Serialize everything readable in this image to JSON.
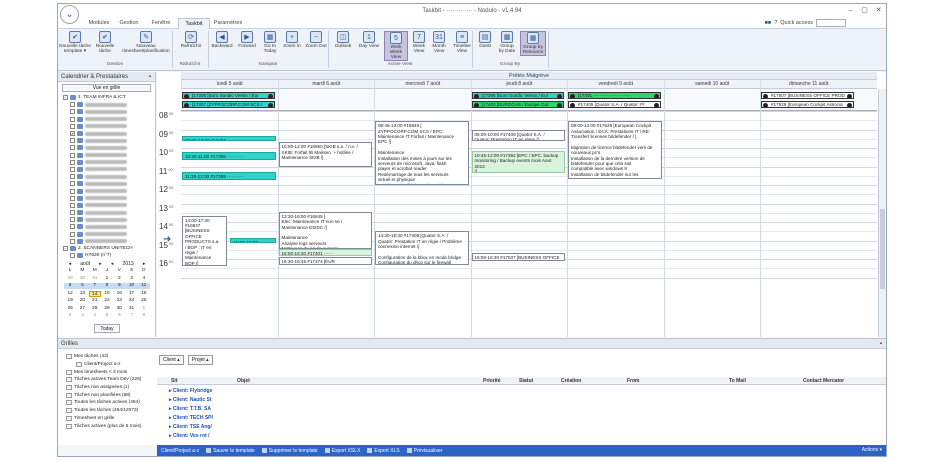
{
  "window": {
    "title": "Taskbit - ·············  - Nodulo - v1.4.94",
    "orb_icon": "chevron-down-icon",
    "controls": [
      "–",
      "▢",
      "✕"
    ]
  },
  "tabs": [
    {
      "label": "Modules"
    },
    {
      "label": "Gestion"
    },
    {
      "label": "Fenêtre"
    },
    {
      "label": "Taskbit",
      "active": true
    },
    {
      "label": "Paramètres"
    }
  ],
  "quick_access": {
    "flag": "■■",
    "help": "?",
    "label": "Quick access"
  },
  "ribbon": {
    "buttons": [
      {
        "label": "Nouvelle tâche\ntemplate ▾",
        "icon": "✔"
      },
      {
        "label": "Nouvelle\ntâche",
        "icon": "✔"
      },
      {
        "label": "Nouveau\ntimesheet/planification",
        "icon": "✎"
      },
      {
        "label": "Rafraîchir",
        "icon": "⟳"
      },
      {
        "label": "Backward",
        "icon": "◀"
      },
      {
        "label": "Forward",
        "icon": "▶"
      },
      {
        "label": "Go to\nToday",
        "icon": "▦"
      },
      {
        "label": "Zoom In",
        "icon": "+"
      },
      {
        "label": "Zoom Out",
        "icon": "−"
      },
      {
        "label": "Outlook",
        "icon": "◫"
      },
      {
        "label": "Day View",
        "icon": "1"
      },
      {
        "label": "Work\nWeek View",
        "icon": "5",
        "selected": true
      },
      {
        "label": "Week\nView",
        "icon": "7"
      },
      {
        "label": "Month\nView",
        "icon": "31"
      },
      {
        "label": "Timeline\nView",
        "icon": "≡"
      },
      {
        "label": "Gantt",
        "icon": "▤"
      },
      {
        "label": "Group\nby Date",
        "icon": "▦"
      },
      {
        "label": "Group by\nResource",
        "icon": "▦",
        "selected": true
      }
    ],
    "groups": [
      {
        "label": "Gestion"
      },
      {
        "label": "Rafraîchir"
      },
      {
        "label": "Navigate"
      },
      {
        "label": "Active View"
      },
      {
        "label": "Group By"
      }
    ]
  },
  "left_panel": {
    "title": "Calendrier & Prestataires",
    "view_button": "Vue en grille",
    "tree": [
      {
        "label": "1. TEAM INFRA & ICT",
        "level": 0,
        "box": "−",
        "icon": true
      },
      {
        "label": "",
        "level": 1,
        "box": ""
      },
      {
        "label": "",
        "level": 1,
        "box": ""
      },
      {
        "label": "",
        "level": 1,
        "box": ""
      },
      {
        "label": "",
        "level": 1,
        "box": ""
      },
      {
        "label": "",
        "level": 1,
        "box": "✔"
      },
      {
        "label": "",
        "level": 1,
        "box": ""
      },
      {
        "label": "",
        "level": 1,
        "box": ""
      },
      {
        "label": "",
        "level": 1,
        "box": ""
      },
      {
        "label": "",
        "level": 1,
        "box": ""
      },
      {
        "label": "",
        "level": 1,
        "box": ""
      },
      {
        "label": "",
        "level": 1,
        "box": ""
      },
      {
        "label": "",
        "level": 1,
        "box": ""
      },
      {
        "label": "",
        "level": 1,
        "box": ""
      },
      {
        "label": "",
        "level": 1,
        "box": ""
      },
      {
        "label": "",
        "level": 1,
        "box": ""
      },
      {
        "label": "",
        "level": 1,
        "box": ""
      },
      {
        "label": "",
        "level": 1,
        "box": ""
      },
      {
        "label": "",
        "level": 1,
        "box": ""
      },
      {
        "label": "",
        "level": 1,
        "box": ""
      },
      {
        "label": "",
        "level": 1,
        "box": ""
      },
      {
        "label": "2. SCANNERS UNITECH",
        "level": 0,
        "box": "−",
        "icon": true
      },
      {
        "label": "HT630 (n°7)",
        "level": 1,
        "box": "",
        "icon": true
      }
    ],
    "mini_calendar": {
      "month": "août",
      "year": "2013",
      "weekdays": [
        "L",
        "M",
        "M",
        "J",
        "V",
        "S",
        "D"
      ],
      "days": [
        "29",
        "30",
        "31",
        "1",
        "2",
        "3",
        "4",
        "5",
        "6",
        "7",
        "8",
        "9",
        "10",
        "11",
        "12",
        "13",
        "14",
        "15",
        "16",
        "17",
        "18",
        "19",
        "20",
        "21",
        "22",
        "23",
        "24",
        "25",
        "26",
        "27",
        "28",
        "29",
        "30",
        "31",
        "1",
        "2",
        "3",
        "4",
        "5",
        "6",
        "7",
        "8"
      ],
      "highlight": [
        "5",
        "6",
        "7",
        "8",
        "9",
        "10",
        "11"
      ],
      "today": "14"
    },
    "today_button": "Today"
  },
  "schedule": {
    "resource": "Prêtés Malgrève",
    "days": [
      "lundi 5 août",
      "mardi 6 août",
      "mercredi 7 août",
      "jeudi 8 août",
      "vendredi 9 août",
      "samedi 10 août",
      "dimanche 11 août"
    ],
    "hours": [
      "08",
      "09",
      "10",
      "11",
      "12",
      "13",
      "14",
      "15",
      "16"
    ],
    "minutes": "00",
    "allday": [
      {
        "day": 0,
        "row": 0,
        "text": "[17306 [Euro Sundic Versio / Eur",
        "color": "teal"
      },
      {
        "day": 0,
        "row": 1,
        "text": "[17307 [ZYPPOCORP.COM SCS /",
        "color": "teal"
      },
      {
        "day": 3,
        "row": 0,
        "text": "[17396 [Euro Sundic Versio / Eur",
        "color": "teal"
      },
      {
        "day": 3,
        "row": 1,
        "text": "[17403 [EUROGAS / Europe Cat",
        "color": "green"
      },
      {
        "day": 4,
        "row": 0,
        "text": "[17401 ························",
        "color": "green"
      },
      {
        "day": 4,
        "row": 1,
        "text": "#17405 [Quator S.A. / Quator: Pr",
        "color": "white"
      },
      {
        "day": 6,
        "row": 0,
        "text": "#17507 [BUSINESS OFFICE PROD",
        "color": "white"
      },
      {
        "day": 6,
        "row": 1,
        "text": "#17529 [European Cockpit Associa",
        "color": "white"
      }
    ],
    "events": [
      {
        "day": 0,
        "start": 9.35,
        "end": 9.6,
        "col": 0,
        "w": 1,
        "color": "teal",
        "text": "09:30-10:00 #17401"
      },
      {
        "day": 0,
        "start": 10.2,
        "end": 10.65,
        "col": 0,
        "w": 1,
        "color": "teal",
        "text": "10:30-11:00 #17399 ···········"
      },
      {
        "day": 0,
        "start": 11.3,
        "end": 11.75,
        "col": 0,
        "w": 1,
        "color": "teal",
        "text": "11:30-12:00 #17398 ···········"
      },
      {
        "day": 0,
        "start": 13.65,
        "end": 16.4,
        "col": 0,
        "w": 0.5,
        "color": "white",
        "text": "14:00-17:30\n#16847\n[BUSINESS\nOFFICE\nPRODUCTS s.a.\n/ BOP : IT en\nrégie /\nMaintenance\nBOP /]\n\nMaintenance\nAnalyse log"
      },
      {
        "day": 0,
        "start": 14.85,
        "end": 15.15,
        "col": 0.5,
        "w": 0.5,
        "color": "teal",
        "text": "15:00-15:30"
      },
      {
        "day": 1,
        "start": 9.7,
        "end": 11.05,
        "col": 0,
        "w": 1,
        "color": "white",
        "text": "10:00-12:00 #16850 [SKIB s.a. / n.v. /\nSKIB: Forfait IB Mainten. + hotline /\nMaintenance SKIB /]\n\nMaintenance\nModification de la version office que"
      },
      {
        "day": 1,
        "start": 13.45,
        "end": 15.45,
        "col": 0,
        "w": 1,
        "color": "white",
        "text": "13:30-16:00 #16845 [\nElec: Maintenance IT non se /\nMaintenance ESIDC /]\n\nMaintenance\nAnalyse logs serveurs\nNettoyage du pc de evgenia"
      },
      {
        "day": 1,
        "start": 15.45,
        "end": 15.85,
        "col": 0,
        "w": 1,
        "color": "green",
        "text": "16:00-16:30 #17401  ······"
      },
      {
        "day": 1,
        "start": 15.9,
        "end": 16.3,
        "col": 0,
        "w": 1,
        "color": "white",
        "text": "16:30-16:45 #17374 [EUR"
      },
      {
        "day": 2,
        "start": 8.55,
        "end": 12.0,
        "col": 0,
        "w": 1,
        "color": "white",
        "text": "08:45-13:00 #16849 [\nZYPPOCORP.COM SCS / EPC:\nMaintenance IT Forfait / Maintenance\nEPC /]\n\nMaintenance\nInstallation des mises à jours sur les\nserveurs de microsoft, Java, flash\nplayer et acrobat reader\nRedémarrage de tous les serveurs\nvirtuel et physique\nProblème de téléphone depuis le\nre-câblage chez Corina et Fabian\nModification du câblage pour les 2 prises\ntéléphone et test -> ok"
      },
      {
        "day": 2,
        "start": 14.5,
        "end": 16.3,
        "col": 0,
        "w": 1,
        "color": "white",
        "text": "14:30-16:30 #17409 [Quator S.A. /\nQuator: Prestation IT en régie / Problème\nconnexion internet /]\n\nConfiguration de la bbox en mode bridge\nConfiguration du dhcp sur le firewall"
      },
      {
        "day": 3,
        "start": 9.0,
        "end": 9.6,
        "col": 0,
        "w": 1,
        "color": "white",
        "text": "09:00-10:00 #17409 [Quator S.A. /\nQuator: Prestation IT en régie /]"
      },
      {
        "day": 3,
        "start": 10.15,
        "end": 11.35,
        "col": 0,
        "w": 1,
        "color": "green",
        "text": "10:45-12:00 #17392 [EPC / EPC: backup\nmonitoring / Backup events mois Aout 2013\n/]\n\nAnalyse problème backup et recherche"
      },
      {
        "day": 3,
        "start": 15.7,
        "end": 16.1,
        "col": 0,
        "w": 1,
        "color": "white",
        "text": "16:00-16:30 #17537 [BUSINESS OFFICE"
      },
      {
        "day": 4,
        "start": 8.55,
        "end": 11.7,
        "col": 0,
        "w": 1,
        "color": "white",
        "text": "09:00-12:00 #17529 [European Cockpit\nAssociation / ECA: Prestations IT / RE:\nTransfert licenses bitdefender / ]\n\nMigration de licence bitdefender vers de\nnouveaux pc's\nInstallation de la dernière version de\nbitdefender pour que cela soit\ncompatible avec windows 8\nInstallation de bitdefender sur les"
      }
    ]
  },
  "grilles": {
    "title": "Grilles",
    "items": [
      {
        "label": "Mes tâches (43)",
        "indent": 0
      },
      {
        "label": "Client/Project a-z",
        "indent": 1
      },
      {
        "label": "Mes timesheets < 3 mois",
        "indent": 0
      },
      {
        "label": "Tâches actives Team Dev (226)",
        "indent": 0
      },
      {
        "label": "Tâches non assignées (1)",
        "indent": 0
      },
      {
        "label": "Tâches non planifiées (88)",
        "indent": 0
      },
      {
        "label": "Toutes les tâches actives  (494)",
        "indent": 0
      },
      {
        "label": "Toutes les tâches (494/12073)",
        "indent": 0
      },
      {
        "label": "Timesheet en grille",
        "indent": 0
      },
      {
        "label": "Tâches actives (plus de 6 mois)",
        "indent": 0
      }
    ],
    "group_tags": [
      "Client",
      "Projet"
    ],
    "columns": [
      "Sit",
      "Objet",
      "Priorité",
      "Statut",
      "Création",
      "From",
      "To Mail",
      "Contact Mercator"
    ],
    "rows": [
      "Client: Flybridge",
      "Client: Nautic St",
      "Client: T.T.B. SA",
      "Client: TECH SPI",
      "Client: TSE Ang/",
      "Client: Vos rot /"
    ],
    "status_bar": {
      "items": [
        "Client/Project a-z",
        "Sauver le template",
        "Supprimer le template",
        "Export XSLX",
        "Export XLS",
        "Prévisualiser"
      ],
      "actions": "Actions ▾"
    }
  }
}
